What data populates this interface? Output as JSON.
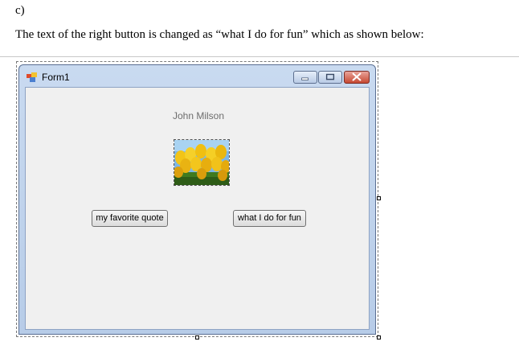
{
  "document": {
    "label": "c)",
    "caption": "The text of the right button is changed as “what I do for fun” which as shown below:"
  },
  "window": {
    "title": "Form1",
    "app_icon": "form-app-icon",
    "controls": {
      "minimize": "minimize-icon",
      "maximize": "maximize-icon",
      "close": "close-icon"
    }
  },
  "form": {
    "name_label": "John Milson",
    "picture": "tulips-image",
    "left_button_label": "my favorite quote",
    "right_button_label": "what I do for fun"
  }
}
